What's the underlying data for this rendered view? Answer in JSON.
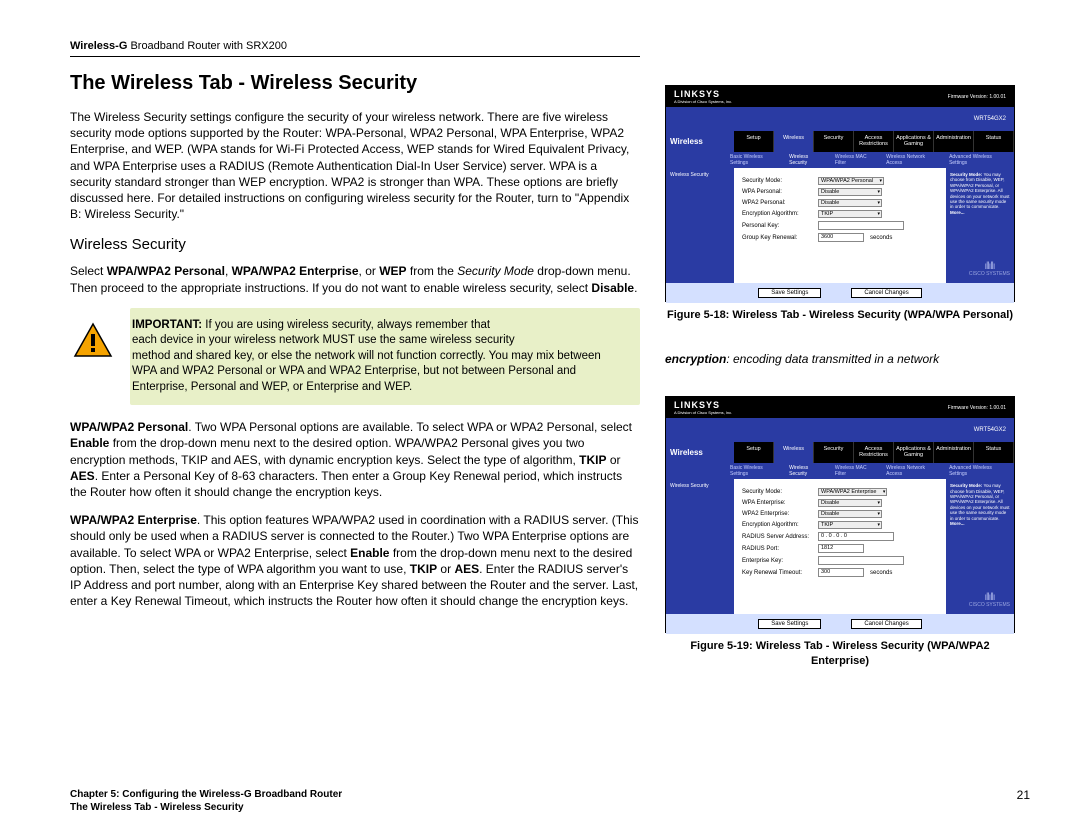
{
  "header": {
    "product_prefix": "Wireless-G ",
    "product_model": "Broadband Router with SRX200"
  },
  "title": "The Wireless Tab - Wireless Security",
  "intro": "The Wireless Security settings configure the security of your wireless network. There are five wireless security mode options supported by the Router: WPA-Personal, WPA2 Personal, WPA Enterprise, WPA2 Enterprise, and WEP. (WPA stands for Wi-Fi Protected Access, WEP stands for Wired Equivalent Privacy, and WPA Enterprise uses a RADIUS (Remote Authentication Dial-In User Service) server. WPA is a security standard stronger than WEP encryption. WPA2 is stronger than WPA. These options are briefly discussed here. For detailed instructions on configuring wireless security for the Router, turn to \"Appendix B: Wireless Security.\"",
  "section_heading": "Wireless Security",
  "select_para": {
    "pre": "Select ",
    "b1": "WPA/WPA2 Personal",
    "c1": ", ",
    "b2": "WPA/WPA2 Enterprise",
    "c2": ", or ",
    "b3": "WEP",
    "c3": " from the ",
    "i1": "Security Mode",
    "c4": " drop-down menu. Then proceed to the appropriate instructions. If you do not want to enable wireless security, select ",
    "b4": "Disable",
    "c5": "."
  },
  "callout": {
    "label": "IMPORTANT:",
    "hl1": "  If you are using wireless security, always remember that",
    "hl2": "each device in your wireless network MUST use the same wireless security",
    "rest": "method and shared key, or else the network will not function correctly. You may mix between WPA and WPA2 Personal or WPA and WPA2 Enterprise, but not between Personal and Enterprise, Personal and WEP, or Enterprise and WEP."
  },
  "personal": {
    "b1": "WPA/WPA2 Personal",
    "t1": ". Two WPA Personal options are available. To select WPA or WPA2 Personal, select ",
    "b2": "Enable",
    "t2": " from the drop-down menu next to the desired option. WPA/WPA2 Personal gives you two encryption methods, TKIP and AES, with dynamic encryption keys. Select the type of algorithm, ",
    "b3": "TKIP",
    "t3": " or ",
    "b4": "AES",
    "t4": ". Enter a Personal Key of 8-63 characters. Then enter a Group Key Renewal period, which instructs the Router how often it should change the encryption keys."
  },
  "enterprise": {
    "b1": "WPA/WPA2 Enterprise",
    "t1": ". This option features WPA/WPA2 used in coordination with a RADIUS server. (This should only be used when a RADIUS server is connected to the Router.) Two WPA Enterprise options are available. To select WPA or WPA2 Enterprise, select ",
    "b2": "Enable",
    "t2": " from the drop-down menu next to the desired option. Then, select the type of WPA algorithm you want to use, ",
    "b3": "TKIP",
    "t3": " or ",
    "b4": "AES",
    "t4": ". Enter the RADIUS server's IP Address and port number, along with an Enterprise Key shared between the Router and the server. Last, enter a Key Renewal Timeout, which instructs the Router how often it should change the encryption keys."
  },
  "figures": {
    "f1_caption": "Figure 5-18: Wireless Tab - Wireless Security (WPA/WPA Personal)",
    "f2_caption": "Figure 5-19: Wireless Tab - Wireless Security (WPA/WPA2 Enterprise)"
  },
  "glossary": {
    "term": "encryption",
    "def": ": encoding data transmitted in a network"
  },
  "router_ui": {
    "logo": "LINKSYS",
    "logo_sub": "A Division of Cisco Systems, Inc.",
    "firmware": "Firmware Version: 1.00.01",
    "model": "WRT54GX2",
    "section": "Wireless",
    "tabs": [
      "Setup",
      "Wireless",
      "Security",
      "Access Restrictions",
      "Applications & Gaming",
      "Administration",
      "Status"
    ],
    "subtabs": [
      "Basic Wireless Settings",
      "Wireless Security",
      "Wireless MAC Filter",
      "Wireless Network Access",
      "Advanced Wireless Settings"
    ],
    "side_label": "Wireless Security",
    "help_title": "Security Mode:",
    "help_text": "You may choose from Disable, WEP, WPA/WPA2 Personal, or WPA/WPA2 Enterprise. All devices on your network must use the same security mode in order to communicate.",
    "more": "More...",
    "btn_save": "Save Settings",
    "btn_cancel": "Cancel Changes",
    "cisco": "CISCO SYSTEMS",
    "fig1": {
      "mode_label": "Security Mode:",
      "mode_val": "WPA/WPA2 Personal",
      "wpa_p_label": "WPA Personal:",
      "wpa_p_val": "Disable",
      "wpa2_p_label": "WPA2 Personal:",
      "wpa2_p_val": "Disable",
      "enc_label": "Encryption Algorithm:",
      "enc_val": "TKIP",
      "key_label": "Personal Key:",
      "renew_label": "Group Key Renewal:",
      "renew_val": "3600",
      "renew_unit": "seconds"
    },
    "fig2": {
      "mode_label": "Security Mode:",
      "mode_val": "WPA/WPA2 Enterprise",
      "wpa_e_label": "WPA Enterprise:",
      "wpa_e_val": "Disable",
      "wpa2_e_label": "WPA2 Enterprise:",
      "wpa2_e_val": "Disable",
      "enc_label": "Encryption Algorithm:",
      "enc_val": "TKIP",
      "radius_addr_label": "RADIUS Server Address:",
      "radius_addr_val": "0 . 0 . 0 . 0",
      "radius_port_label": "RADIUS Port:",
      "radius_port_val": "1812",
      "ent_key_label": "Enterprise Key:",
      "timeout_label": "Key Renewal Timeout:",
      "timeout_val": "300",
      "timeout_unit": "seconds"
    }
  },
  "footer": {
    "chapter": "Chapter 5: Configuring the Wireless-G Broadband Router",
    "section": "The Wireless Tab - Wireless Security",
    "page": "21"
  }
}
